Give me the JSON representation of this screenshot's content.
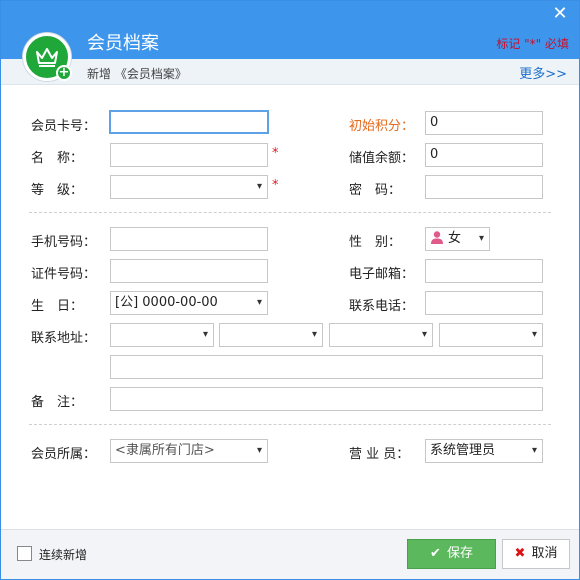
{
  "window": {
    "title": "会员档案",
    "close_glyph": "✕",
    "required_note": "标记 \"*\" 必填",
    "logo_icon": "crown-icon",
    "breadcrumb": "新增 《会员档案》",
    "more_link": "更多>>"
  },
  "form": {
    "card_no": {
      "label": "会员卡号：",
      "value": ""
    },
    "init_points": {
      "label": "初始积分：",
      "value": "0"
    },
    "name": {
      "label": "名　称：",
      "value": ""
    },
    "stored_balance": {
      "label": "储值余额：",
      "value": "0"
    },
    "level": {
      "label": "等　级：",
      "value": ""
    },
    "password": {
      "label": "密　码：",
      "value": ""
    },
    "phone": {
      "label": "手机号码：",
      "value": ""
    },
    "gender": {
      "label": "性　别：",
      "value": "女",
      "options_visible": [
        "女"
      ]
    },
    "id_no": {
      "label": "证件号码：",
      "value": ""
    },
    "email": {
      "label": "电子邮箱：",
      "value": ""
    },
    "birthday": {
      "label": "生　日：",
      "value": "[公] 0000-00-00"
    },
    "contact_phone": {
      "label": "联系电话：",
      "value": ""
    },
    "address": {
      "label": "联系地址：",
      "province": "",
      "city": "",
      "district": "",
      "street": "",
      "detail": ""
    },
    "remark": {
      "label": "备　注：",
      "value": ""
    },
    "store": {
      "label": "会员所属：",
      "value": "<隶属所有门店>"
    },
    "salesperson": {
      "label": "营 业 员：",
      "value": "系统管理员"
    },
    "required_marker": "*"
  },
  "footer": {
    "continuous_add_label": "连续新增",
    "continuous_add_checked": false,
    "save_label": "保存",
    "cancel_label": "取消"
  },
  "colors": {
    "title_bar": "#3e96ec",
    "accent_green": "#5cb85c",
    "required_red": "#d91c1c",
    "link_blue": "#1c6fc9"
  }
}
